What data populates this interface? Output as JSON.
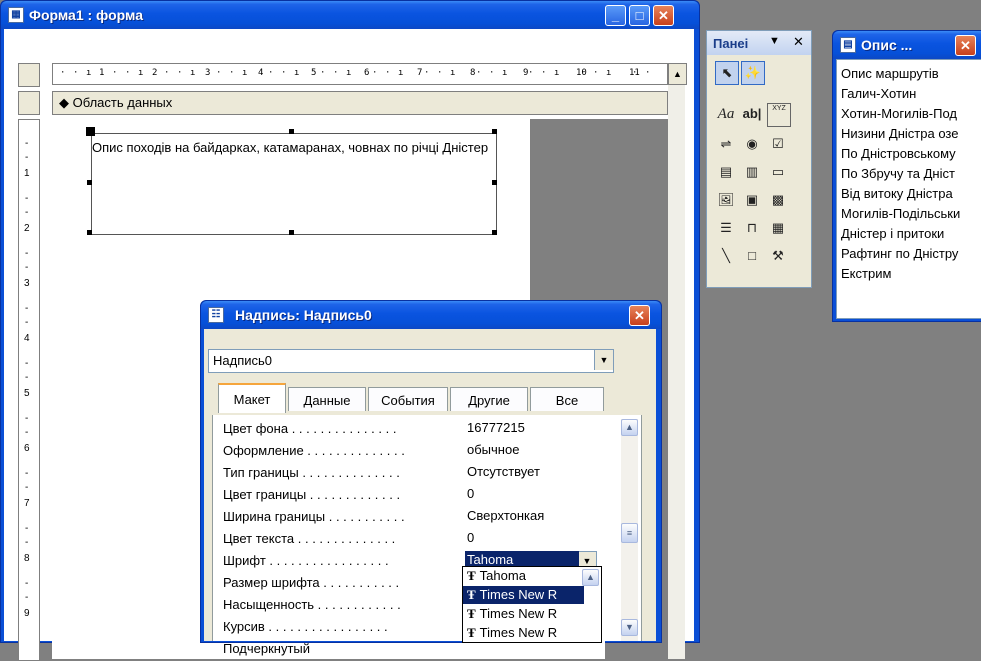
{
  "form_window": {
    "title": "Форма1 : форма",
    "ruler_numbers": [
      "1",
      "2",
      "3",
      "4",
      "5",
      "6",
      "7",
      "8",
      "9",
      "10",
      "11"
    ],
    "left_ruler_numbers": [
      "1",
      "2",
      "3",
      "4",
      "5",
      "6",
      "7",
      "8",
      "9"
    ],
    "section_label": "Область данных",
    "label_text": "Опис походів на байдарках, катамаранах, човнах по річці Дністер"
  },
  "toolbox": {
    "title": "Панеі",
    "icons": [
      "select-objects-icon",
      "control-wizards-icon",
      "label-icon",
      "textbox-icon",
      "option-group-icon",
      "toggle-button-icon",
      "option-button-icon",
      "checkbox-icon",
      "combobox-icon",
      "listbox-icon",
      "command-button-icon",
      "image-icon",
      "unbound-object-frame-icon",
      "bound-object-frame-icon",
      "page-break-icon",
      "tab-control-icon",
      "subform-icon",
      "line-icon",
      "rectangle-icon",
      "more-controls-icon"
    ],
    "label_glyph": "Aa",
    "textbox_glyph": "ab|",
    "xyz_glyph": "XYZ"
  },
  "list_window": {
    "title": "Опис ...",
    "items": [
      "Опис маршрутів",
      "Галич-Хотин",
      "Хотин-Могилів-Под",
      "Низини Дністра озе",
      "По Дністровському",
      "По Збручу та Дніст",
      "Від витоку Дністра",
      "Могилів-Подільськи",
      "Дністер і притоки",
      "Рафтинг по Дністру",
      "Екстрим"
    ]
  },
  "property_sheet": {
    "title": "Надпись: Надпись0",
    "object_selector_value": "Надпись0",
    "tabs": [
      "Макет",
      "Данные",
      "События",
      "Другие",
      "Все"
    ],
    "properties": [
      {
        "label": "Цвет фона . . . . . . . . . . . . . . .",
        "value": "16777215"
      },
      {
        "label": "Оформление . . . . . . . . . . . . . .",
        "value": "обычное"
      },
      {
        "label": "Тип границы . . . . . . . . . . . . . .",
        "value": "Отсутствует"
      },
      {
        "label": "Цвет границы . . . . . . . . . . . . .",
        "value": "0"
      },
      {
        "label": "Ширина границы . . . . . . . . . . .",
        "value": "Сверхтонкая"
      },
      {
        "label": "Цвет текста . . . . . . . . . . . . . .",
        "value": "0"
      },
      {
        "label": "Шрифт . . . . . . . . . . . . . . . . .",
        "value": "Tahoma"
      },
      {
        "label": "Размер шрифта . . . . . . . . . . .",
        "value": ""
      },
      {
        "label": "Насыщенность . . . . . . . . . . . .",
        "value": ""
      },
      {
        "label": "Курсив . . . . . . . . . . . . . . . . .",
        "value": ""
      },
      {
        "label": "Подчеркнутый",
        "value": ""
      }
    ],
    "font_dropdown": [
      "Tahoma",
      "Times New R",
      "Times New R",
      "Times New R"
    ],
    "font_glyph": "Ŧ"
  },
  "colors": {
    "titlebar": "#0a54e0",
    "face": "#ece9d8",
    "selection": "#0a246a"
  }
}
